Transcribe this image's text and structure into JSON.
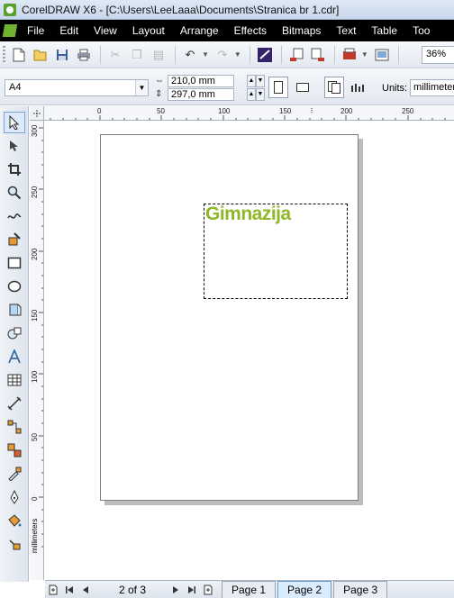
{
  "window": {
    "title": "CorelDRAW X6 - [C:\\Users\\LeeLaaa\\Documents\\Stranica br 1.cdr]"
  },
  "menubar": {
    "items": [
      "File",
      "Edit",
      "View",
      "Layout",
      "Arrange",
      "Effects",
      "Bitmaps",
      "Text",
      "Table",
      "Too"
    ]
  },
  "toolbar": {
    "zoom_value": "36%"
  },
  "property_bar": {
    "page_size": "A4",
    "width_value": "210,0 mm",
    "height_value": "297,0 mm",
    "units_label": "Units:",
    "units_value": "millimeters"
  },
  "rulers": {
    "horizontal_ticks": [
      "0",
      "50",
      "100",
      "150",
      "200",
      "250"
    ],
    "vertical_ticks": [
      "300",
      "250",
      "200",
      "150",
      "100",
      "50",
      "0"
    ],
    "unit_label": "millimeters"
  },
  "document": {
    "text_content": "Gimnazija"
  },
  "page_navigator": {
    "page_count": "2 of 3",
    "tabs": [
      "Page 1",
      "Page 2",
      "Page 3"
    ],
    "active_tab": "Page 2"
  },
  "colors": {
    "text_green": "#8fb828",
    "menubar_bg": "#000000",
    "active_tab": "#dcecff"
  }
}
